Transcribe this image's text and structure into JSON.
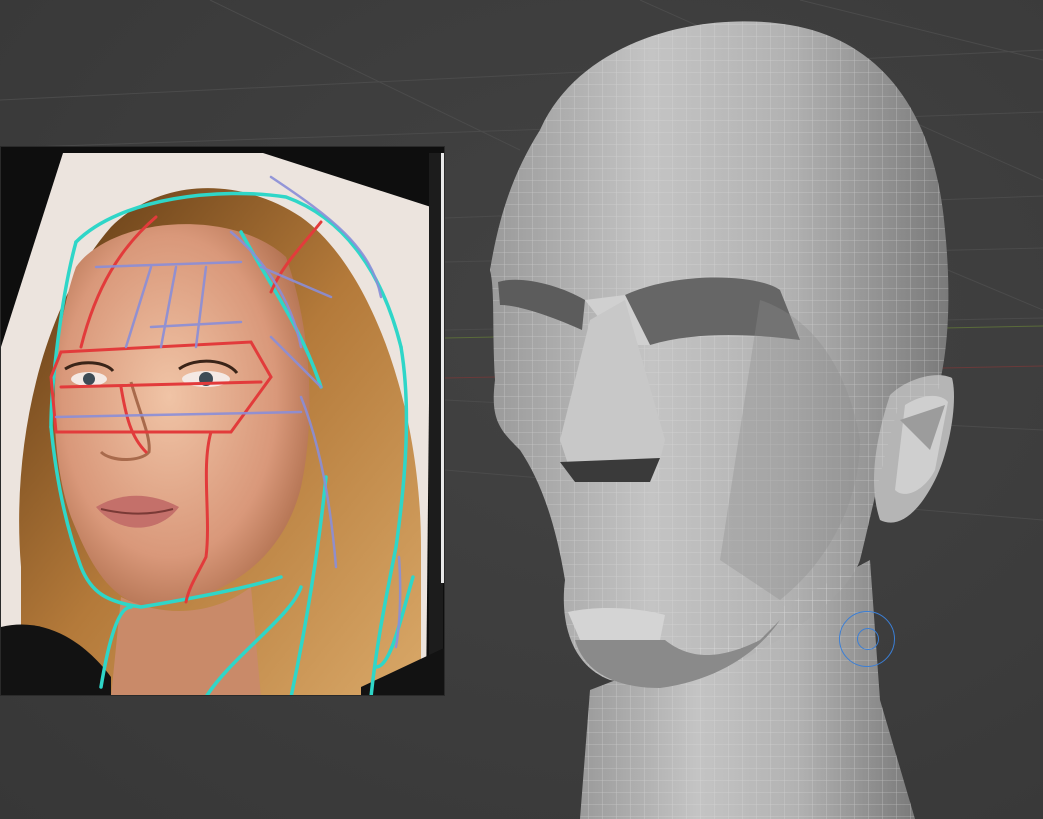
{
  "viewport": {
    "background": "#3d3d3d",
    "grid_color": "#4a4a4a",
    "mesh_color": "#b8b8b8",
    "mesh_line_color": "#d9d9d9"
  },
  "reference_image": {
    "guide_colors": {
      "outline": "#2fd6c8",
      "structure": "#e23b3b",
      "planes": "#8a8ed8"
    }
  },
  "brush_cursor": {
    "color": "#3b7fd6"
  }
}
